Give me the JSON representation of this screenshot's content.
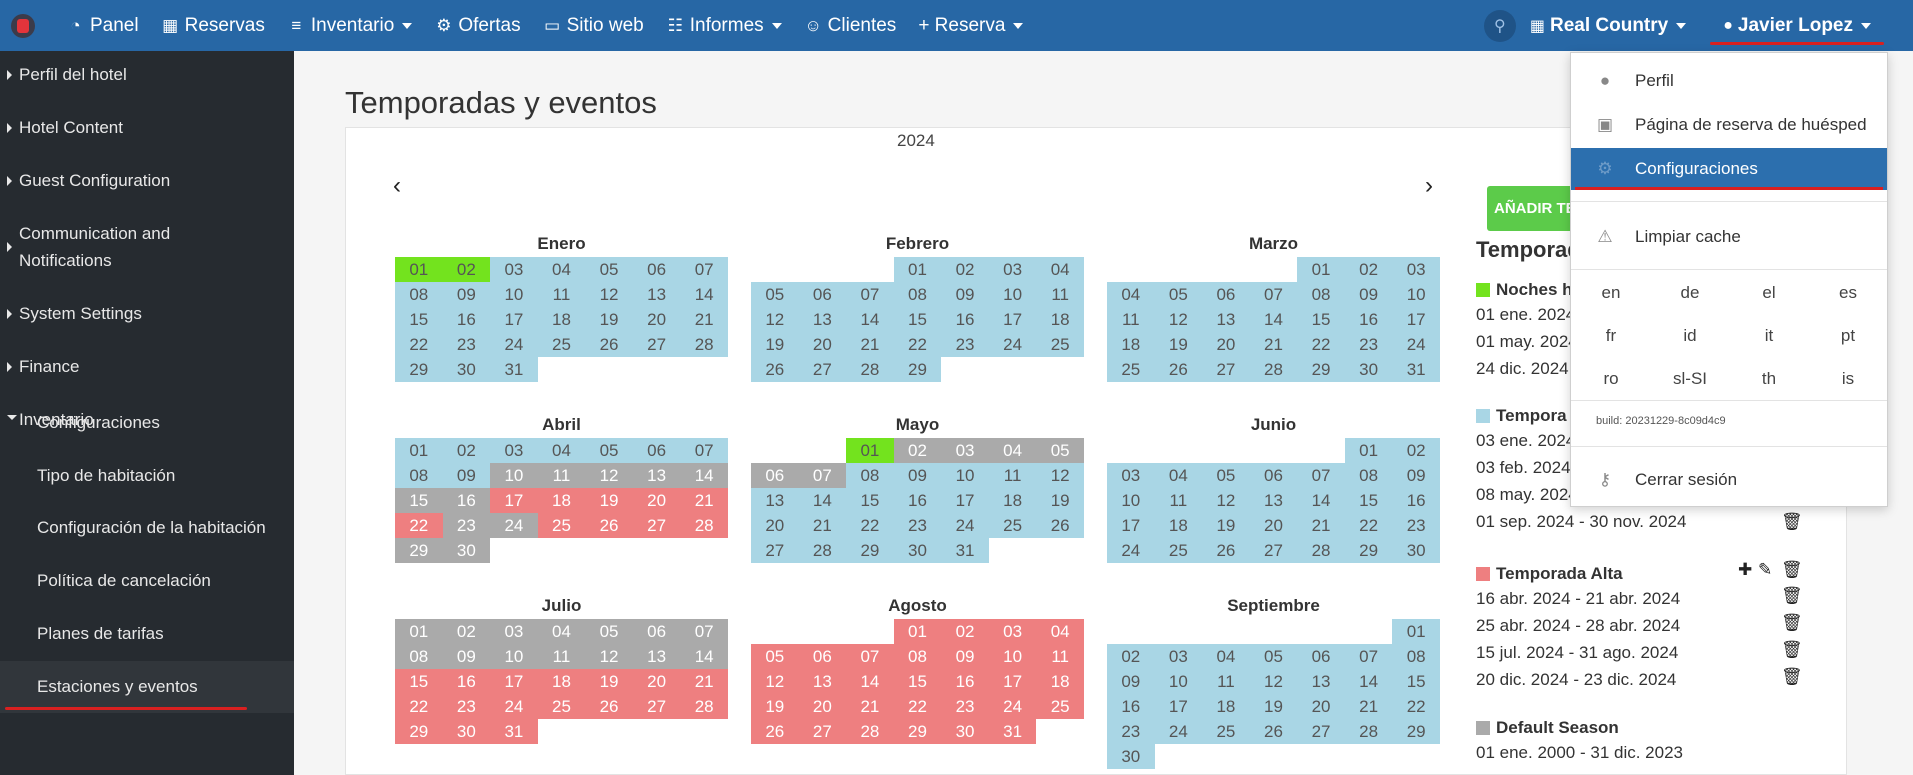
{
  "topbar": {
    "menu": [
      {
        "label": "Panel",
        "icon": "dashboard-icon",
        "caret": false
      },
      {
        "label": "Reservas",
        "icon": "grid-icon",
        "caret": false
      },
      {
        "label": "Inventario",
        "icon": "database-icon",
        "caret": true
      },
      {
        "label": "Ofertas",
        "icon": "gear-icon",
        "caret": false
      },
      {
        "label": "Sitio web",
        "icon": "monitor-icon",
        "caret": false
      },
      {
        "label": "Informes",
        "icon": "file-icon",
        "caret": true
      },
      {
        "label": "Clientes",
        "icon": "users-icon",
        "caret": false
      },
      {
        "label": "+ Reserva",
        "icon": "",
        "caret": true
      }
    ],
    "hotel": "Real Country",
    "user": "Javier Lopez"
  },
  "sidebar": {
    "items": [
      {
        "label": "Perfil del hotel",
        "expanded": false
      },
      {
        "label": "Hotel Content",
        "expanded": false
      },
      {
        "label": "Guest Configuration",
        "expanded": false
      },
      {
        "label": "Communication and\nNotifications",
        "expanded": false
      },
      {
        "label": "System Settings",
        "expanded": false
      },
      {
        "label": "Finance",
        "expanded": false
      },
      {
        "label": "Inventario",
        "expanded": true
      }
    ],
    "subitems": [
      {
        "label": "Configuraciones",
        "active": false
      },
      {
        "label": "Tipo de habitación",
        "active": false
      },
      {
        "label": "Configuración de la habitación",
        "active": false
      },
      {
        "label": "Política de cancelación",
        "active": false
      },
      {
        "label": "Planes de tarifas",
        "active": false
      },
      {
        "label": "Estaciones y eventos",
        "active": true
      }
    ]
  },
  "page": {
    "title": "Temporadas y eventos",
    "year": "2024",
    "add_button": "AÑADIR TE",
    "seasons_title": "Temporad"
  },
  "calendar": {
    "colors": {
      "b": "#a9d6e5",
      "g": "#aaaaaa",
      "r": "#ee7f80",
      "l": "#73e31e"
    },
    "months": [
      {
        "name": "Enero",
        "offset": 0,
        "days": 31,
        "codes": "llbbbbbbbbbbbbbbbbbbbbbbbbbbbbb"
      },
      {
        "name": "Febrero",
        "offset": 3,
        "days": 29,
        "codes": "bbbbbbbbbbbbbbbbbbbbbbbbbbbbb"
      },
      {
        "name": "Marzo",
        "offset": 4,
        "days": 31,
        "codes": "bbbbbbbbbbbbbbbbbbbbbbbbbbbbbbb"
      },
      {
        "name": "Abril",
        "offset": 0,
        "days": 30,
        "codes": "bbbbbbbbbgggggggrrrrrrggrrrrgg"
      },
      {
        "name": "Mayo",
        "offset": 2,
        "days": 31,
        "codes": "lggggggbbbbbbbbbbbbbbbbbbbbbbbb"
      },
      {
        "name": "Junio",
        "offset": 5,
        "days": 30,
        "codes": "bbbbbbbbbbbbbbbbbbbbbbbbbbbbbb"
      },
      {
        "name": "Julio",
        "offset": 0,
        "days": 31,
        "codes": "ggggggggggggggrrrrrrrrrrrrrrrrr"
      },
      {
        "name": "Agosto",
        "offset": 3,
        "days": 31,
        "codes": "rrrrrrrrrrrrrrrrrrrrrrrrrrrrrrr"
      },
      {
        "name": "Septiembre",
        "offset": 6,
        "days": 30,
        "codes": "bbbbbbbbbbbbbbbbbbbbbbbbbbbbbb"
      }
    ]
  },
  "seasons": [
    {
      "name": "Noches h",
      "color": "#73e31e",
      "ranges": [
        "01 ene. 2024",
        "01 may. 2024",
        "24 dic. 2024"
      ]
    },
    {
      "name": "Tempora",
      "color": "#a9d6e5",
      "ranges": [
        "03 ene. 2024",
        "03 feb. 2024",
        "08 may. 2024",
        "01 sep. 2024 - 30 nov. 2024"
      ]
    },
    {
      "name": "Temporada Alta",
      "color": "#ee7f80",
      "ranges": [
        "16 abr. 2024 - 21 abr. 2024",
        "25 abr. 2024 - 28 abr. 2024",
        "15 jul. 2024 - 31 ago. 2024",
        "20 dic. 2024 - 23 dic. 2024"
      ]
    },
    {
      "name": "Default Season",
      "color": "#aaaaaa",
      "ranges": [
        "01 ene. 2000 - 31 dic. 2023"
      ]
    }
  ],
  "dropdown": {
    "items": [
      {
        "label": "Perfil",
        "icon": "user-icon"
      },
      {
        "label": "Página de reserva de huésped",
        "icon": "luggage-icon"
      },
      {
        "label": "Configuraciones",
        "icon": "gear-icon",
        "active": true
      },
      {
        "label": "Limpiar cache",
        "icon": "warning-icon"
      },
      {
        "label": "Cerrar sesión",
        "icon": "key-icon"
      }
    ],
    "languages": [
      "en",
      "de",
      "el",
      "es",
      "fr",
      "id",
      "it",
      "pt",
      "ro",
      "sl-SI",
      "th",
      "is"
    ],
    "build": "build: 20231229-8c09d4c9"
  }
}
